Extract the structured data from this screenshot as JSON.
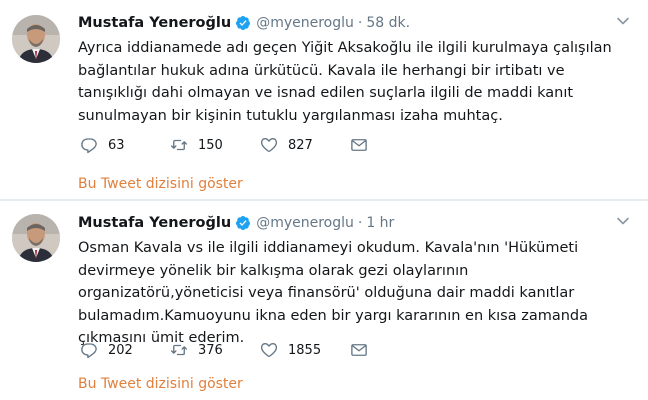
{
  "tweets": [
    {
      "author_name": "Mustafa Yeneroğlu",
      "handle": "@myeneroglu",
      "separator": "·",
      "time": "58 dk.",
      "text": "Ayrıca iddianamede adı geçen Yiğit Aksakoğlu ile ilgili kurulmaya çalışılan bağlantılar hukuk adına ürkütücü. Kavala ile herhangi bir irtibatı ve tanışıklığı dahi olmayan ve isnad edilen suçlarla ilgili de maddi kanıt sunulmayan bir kişinin tutuklu yargılanması izaha muhtaç.",
      "replies": "63",
      "retweets": "150",
      "likes": "827",
      "show_thread": "Bu Tweet dizisini göster"
    },
    {
      "author_name": "Mustafa Yeneroğlu",
      "handle": "@myeneroglu",
      "separator": "·",
      "time": "1 hr",
      "text": "Osman Kavala vs ile ilgili iddianameyi okudum. Kavala'nın 'Hükümeti devirmeye yönelik bir kalkışma olarak gezi olaylarının organizatörü,yöneticisi veya finansörü' olduğuna dair maddi kanıtlar bulamadım.Kamuoyunu ikna eden bir yargı kararının en kısa zamanda çıkmasını ümit ederim.",
      "replies": "202",
      "retweets": "376",
      "likes": "1855",
      "show_thread": "Bu Tweet dizisini göster"
    }
  ],
  "colors": {
    "text": "#14171a",
    "muted": "#657786",
    "verified": "#1da1f2",
    "show_thread": "#e0803c",
    "divider": "#e6ecf0"
  },
  "icons": {
    "reply": "reply-icon",
    "retweet": "retweet-icon",
    "like": "heart-icon",
    "dm": "envelope-icon",
    "caret": "chevron-down-icon",
    "verified": "verified-badge-icon"
  }
}
